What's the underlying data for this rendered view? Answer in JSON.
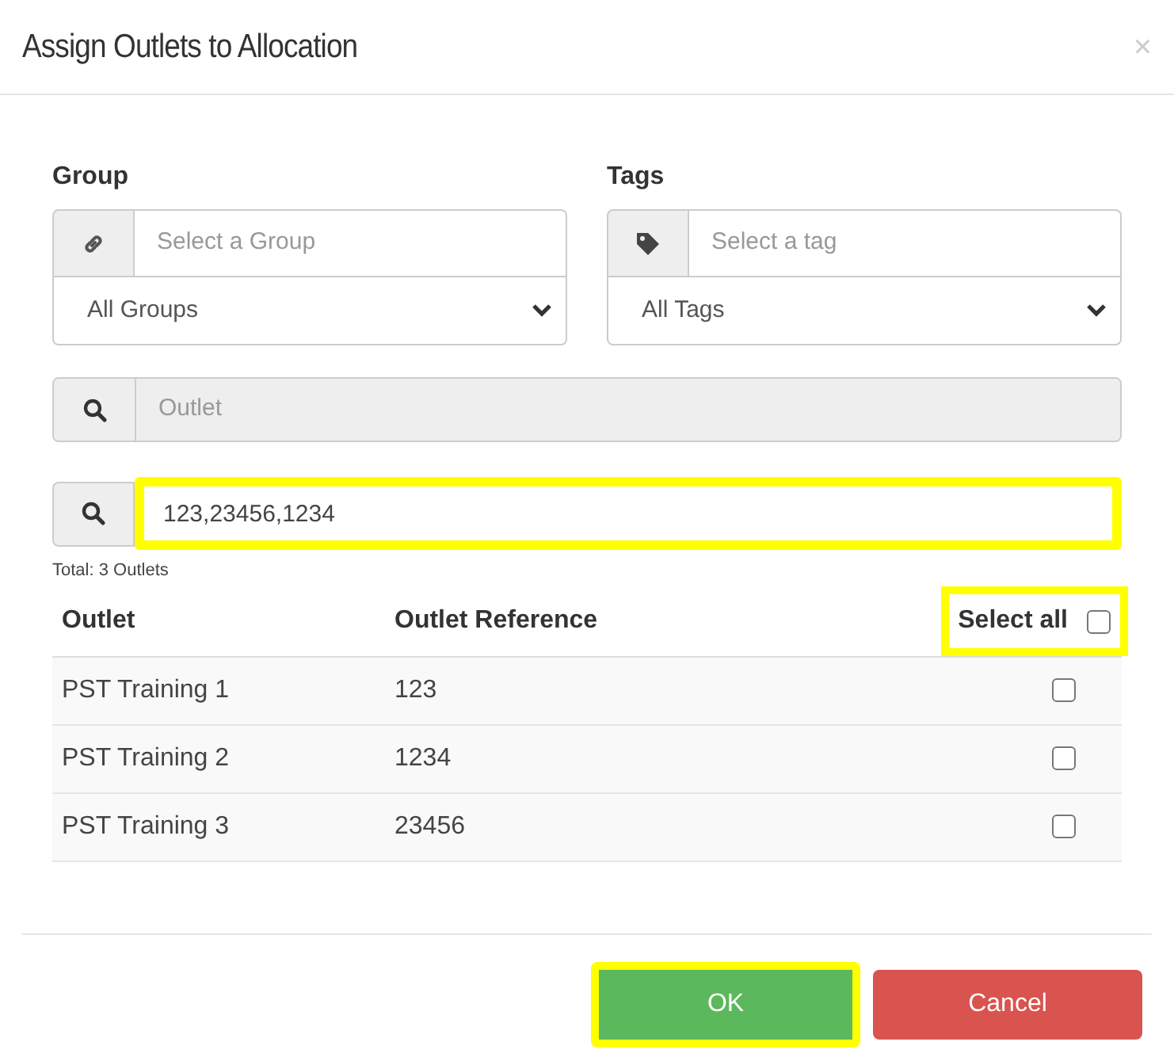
{
  "dialog": {
    "title": "Assign Outlets to Allocation",
    "close": "×"
  },
  "group": {
    "label": "Group",
    "placeholder": "Select a Group",
    "value": "All Groups"
  },
  "tags": {
    "label": "Tags",
    "placeholder": "Select a tag",
    "value": "All Tags"
  },
  "outlet_search": {
    "placeholder": "Outlet",
    "disabled": true
  },
  "reference_search": {
    "value": "123,23456,1234",
    "highlighted": true
  },
  "total": "Total: 3 Outlets",
  "table": {
    "columns": [
      "Outlet",
      "Outlet Reference"
    ],
    "select_all": {
      "label": "Select all",
      "checked": false,
      "highlighted": true
    },
    "rows": [
      {
        "outlet": "PST Training 1",
        "reference": "123",
        "checked": false
      },
      {
        "outlet": "PST Training 2",
        "reference": "1234",
        "checked": false
      },
      {
        "outlet": "PST Training 3",
        "reference": "23456",
        "checked": false
      }
    ]
  },
  "buttons": [
    {
      "label": "OK",
      "kind": "ok",
      "highlighted": true
    },
    {
      "label": "Cancel",
      "kind": "cancel",
      "highlighted": false
    }
  ]
}
